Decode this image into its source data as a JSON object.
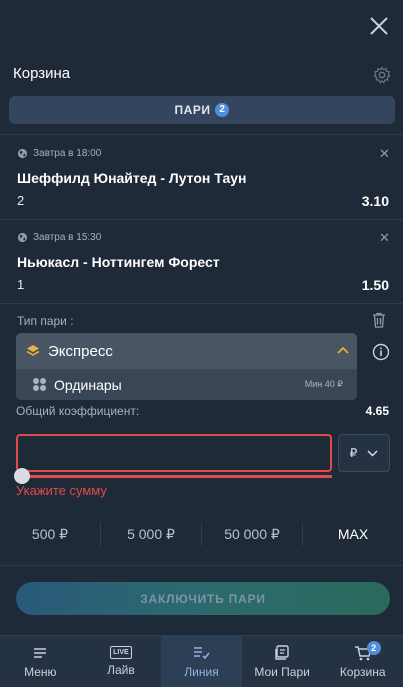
{
  "header": {
    "title": "Корзина"
  },
  "tabs": {
    "pari_label": "ПАРИ",
    "pari_count": "2"
  },
  "bets": [
    {
      "time": "Завтра в 18:00",
      "match": "Шеффилд Юнайтед - Лутон Таун",
      "outcome": "2",
      "odds": "3.10"
    },
    {
      "time": "Завтра в 15:30",
      "match": "Ньюкасл - Ноттингем Форест",
      "outcome": "1",
      "odds": "1.50"
    }
  ],
  "bet_type": {
    "label": "Тип пари :",
    "selected": "Экспресс",
    "option": "Ординары",
    "option_min": "Мин 40 ₽"
  },
  "total": {
    "label": "Общий коэффициент:",
    "value": "4.65"
  },
  "amount": {
    "value": "",
    "currency": "₽",
    "error": "Укажите сумму"
  },
  "quick_amounts": [
    "500 ₽",
    "5 000 ₽",
    "50 000 ₽",
    "MAX"
  ],
  "submit_label": "ЗАКЛЮЧИТЬ ПАРИ",
  "nav": [
    {
      "label": "Меню"
    },
    {
      "label": "Лайв",
      "badge_text": "LIVE"
    },
    {
      "label": "Линия"
    },
    {
      "label": "Мои Пари"
    },
    {
      "label": "Корзина",
      "badge": "2"
    }
  ],
  "colors": {
    "background": "#1f2a38",
    "accent": "#4f8fd9",
    "error": "#e04a4a"
  }
}
